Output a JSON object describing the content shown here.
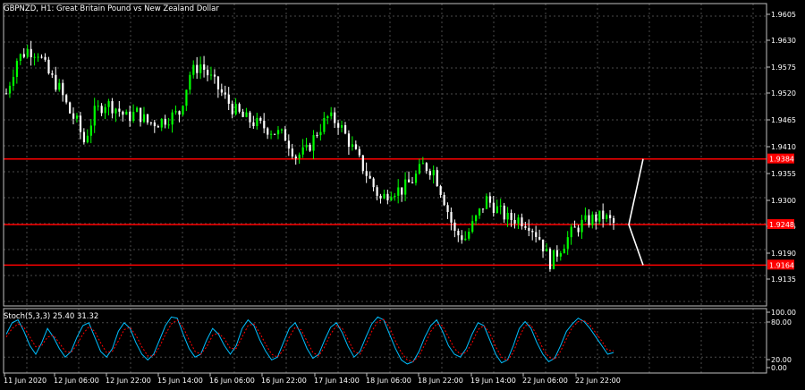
{
  "chart_data": [
    {
      "type": "candlestick",
      "title": "GBPNZD, H1:  Great Britain Pound vs New Zealand Dollar",
      "ylim": [
        1.9105,
        1.9625
      ],
      "price_ticks": [
        "1.9605",
        "1.9630",
        "1.9575",
        "1.9520",
        "1.9465",
        "1.9410",
        "1.9355",
        "1.9300",
        "1.9245",
        "1.9190",
        "1.9135"
      ],
      "price_tick_values": [
        1.9605,
        1.963,
        1.9575,
        1.952,
        1.9465,
        1.941,
        1.9355,
        1.93,
        1.9245,
        1.919,
        1.9135
      ],
      "grid": true,
      "up_color": "#00ff00",
      "down_color": "#ffffff",
      "levels": [
        {
          "label": "1.9384",
          "value": 1.9384,
          "color": "#ff0000"
        },
        {
          "label": "1.9248",
          "value": 1.9248,
          "color": "#ff0000"
        },
        {
          "label": "1.9164",
          "value": 1.9164,
          "color": "#ff0000"
        }
      ],
      "close_path": [
        [
          0,
          1.952
        ],
        [
          3,
          1.959
        ],
        [
          6,
          1.961
        ],
        [
          9,
          1.9605
        ],
        [
          12,
          1.956
        ],
        [
          15,
          1.953
        ],
        [
          18,
          1.948
        ],
        [
          20,
          1.946
        ],
        [
          22,
          1.942
        ],
        [
          25,
          1.948
        ],
        [
          28,
          1.95
        ],
        [
          31,
          1.949
        ],
        [
          34,
          1.947
        ],
        [
          37,
          1.948
        ],
        [
          40,
          1.946
        ],
        [
          43,
          1.946
        ],
        [
          46,
          1.947
        ],
        [
          49,
          1.948
        ],
        [
          52,
          1.956
        ],
        [
          55,
          1.958
        ],
        [
          58,
          1.955
        ],
        [
          61,
          1.952
        ],
        [
          64,
          1.949
        ],
        [
          67,
          1.947
        ],
        [
          70,
          1.946
        ],
        [
          73,
          1.945
        ],
        [
          76,
          1.944
        ],
        [
          79,
          1.943
        ],
        [
          82,
          1.939
        ],
        [
          85,
          1.94
        ],
        [
          88,
          1.944
        ],
        [
          91,
          1.947
        ],
        [
          94,
          1.946
        ],
        [
          97,
          1.942
        ],
        [
          100,
          1.938
        ],
        [
          103,
          1.934
        ],
        [
          106,
          1.93
        ],
        [
          109,
          1.932
        ],
        [
          112,
          1.932
        ],
        [
          115,
          1.934
        ],
        [
          118,
          1.937
        ],
        [
          121,
          1.936
        ],
        [
          124,
          1.93
        ],
        [
          127,
          1.923
        ],
        [
          130,
          1.922
        ],
        [
          133,
          1.926
        ],
        [
          136,
          1.93
        ],
        [
          139,
          1.928
        ],
        [
          142,
          1.926
        ],
        [
          145,
          1.926
        ],
        [
          148,
          1.925
        ],
        [
          151,
          1.922
        ],
        [
          154,
          1.917
        ],
        [
          157,
          1.92
        ],
        [
          160,
          1.923
        ],
        [
          163,
          1.925
        ],
        [
          166,
          1.926
        ],
        [
          169,
          1.9265
        ],
        [
          172,
          1.925
        ]
      ],
      "projection": {
        "color": "#ffffff",
        "points": [
          [
            0,
            1.9384
          ],
          [
            1,
            1.9248
          ],
          [
            2,
            1.9164
          ]
        ]
      }
    },
    {
      "type": "line",
      "title": "Stoch(5,3,3) 25.40 31.32",
      "ylim": [
        0,
        100
      ],
      "y_ticks": [
        "100.00",
        "80.00",
        "20.00",
        "0.00"
      ],
      "y_tick_values": [
        100,
        80,
        20,
        0
      ],
      "series": [
        {
          "color": "#00bfff",
          "style": "solid",
          "values": [
            60,
            80,
            85,
            65,
            40,
            25,
            45,
            70,
            55,
            35,
            20,
            30,
            55,
            75,
            80,
            55,
            30,
            20,
            35,
            65,
            80,
            70,
            45,
            25,
            15,
            25,
            50,
            75,
            90,
            88,
            60,
            35,
            20,
            25,
            50,
            70,
            60,
            40,
            25,
            40,
            70,
            85,
            75,
            50,
            30,
            15,
            20,
            45,
            70,
            80,
            60,
            35,
            18,
            25,
            50,
            72,
            80,
            62,
            38,
            20,
            30,
            55,
            78,
            90,
            85,
            60,
            35,
            15,
            8,
            12,
            30,
            55,
            75,
            85,
            65,
            40,
            25,
            20,
            35,
            60,
            80,
            75,
            50,
            25,
            10,
            15,
            40,
            70,
            82,
            70,
            45,
            25,
            12,
            18,
            40,
            65,
            78,
            88,
            82,
            70,
            55,
            40,
            25,
            28
          ]
        },
        {
          "color": "#ff0000",
          "style": "dotted",
          "values": [
            55,
            70,
            78,
            72,
            55,
            38,
            40,
            55,
            58,
            45,
            30,
            28,
            42,
            60,
            73,
            65,
            45,
            28,
            30,
            48,
            68,
            72,
            58,
            38,
            22,
            22,
            38,
            60,
            78,
            85,
            72,
            50,
            30,
            25,
            38,
            58,
            62,
            52,
            35,
            35,
            55,
            75,
            78,
            62,
            42,
            25,
            20,
            32,
            55,
            72,
            68,
            48,
            28,
            22,
            38,
            60,
            75,
            70,
            50,
            30,
            25,
            42,
            65,
            82,
            86,
            72,
            48,
            28,
            15,
            12,
            22,
            42,
            65,
            78,
            75,
            55,
            35,
            25,
            28,
            45,
            68,
            75,
            62,
            38,
            20,
            14,
            28,
            55,
            75,
            76,
            58,
            35,
            20,
            16,
            30,
            52,
            72,
            82,
            84,
            76,
            62,
            48,
            32,
            31
          ]
        }
      ]
    }
  ],
  "time_axis": [
    "11 Jun 2020",
    "12 Jun 06:00",
    "12 Jun 22:00",
    "15 Jun 14:00",
    "16 Jun 06:00",
    "16 Jun 22:00",
    "17 Jun 14:00",
    "18 Jun 06:00",
    "18 Jun 22:00",
    "19 Jun 14:00",
    "22 Jun 06:00",
    "22 Jun 22:00"
  ]
}
